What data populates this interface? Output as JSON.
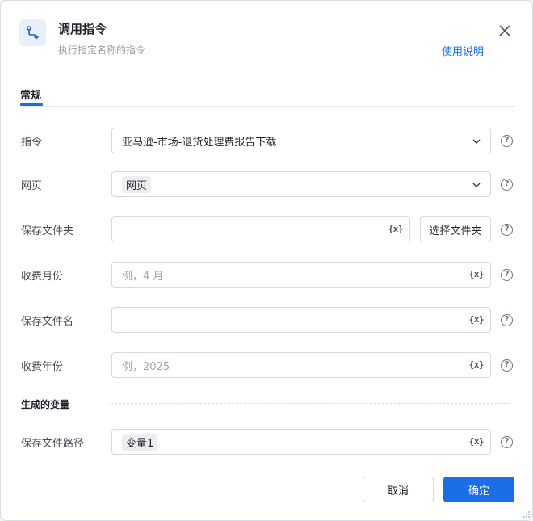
{
  "dialog": {
    "title": "调用指令",
    "subtitle": "执行指定名称的指令",
    "help_link": "使用说明"
  },
  "tabs": [
    {
      "label": "常规",
      "active": true
    }
  ],
  "fields": {
    "command": {
      "label": "指令",
      "value": "亚马逊-市场-退货处理费报告下载"
    },
    "webpage": {
      "label": "网页",
      "value": "网页"
    },
    "save_folder": {
      "label": "保存文件夹",
      "value": "",
      "button": "选择文件夹"
    },
    "fee_month": {
      "label": "收费月份",
      "placeholder": "例，4 月"
    },
    "save_filename": {
      "label": "保存文件名",
      "value": ""
    },
    "fee_year": {
      "label": "收费年份",
      "placeholder": "例，2025"
    }
  },
  "output_section": {
    "title": "生成的变量",
    "save_path": {
      "label": "保存文件路径",
      "value": "变量1"
    }
  },
  "icons": {
    "variable_icon_text": "{x}",
    "help_icon_text": "?"
  },
  "footer": {
    "cancel": "取消",
    "confirm": "确定"
  },
  "colors": {
    "accent": "#1a6fe8"
  }
}
